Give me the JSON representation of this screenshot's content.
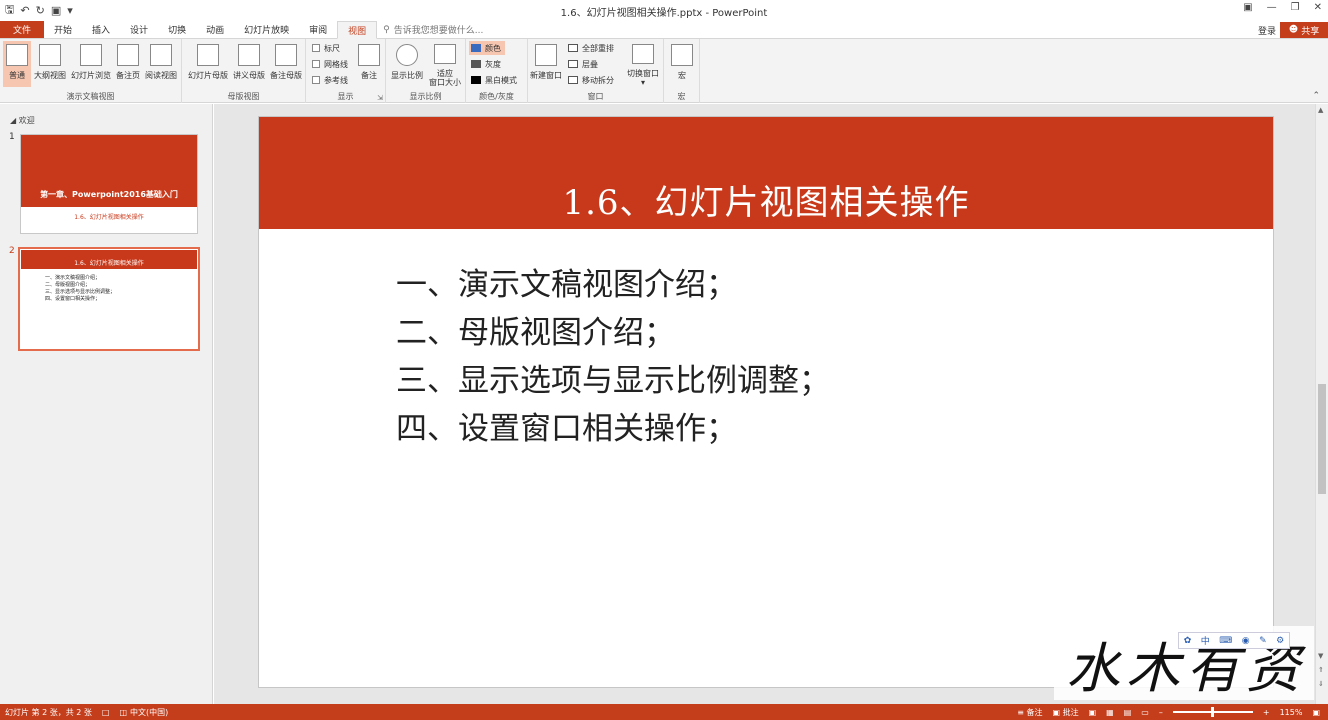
{
  "window": {
    "title": "1.6、幻灯片视图相关操作.pptx - PowerPoint",
    "login": "登录",
    "share": "共享"
  },
  "tabs": [
    "文件",
    "开始",
    "插入",
    "设计",
    "切换",
    "动画",
    "幻灯片放映",
    "审阅",
    "视图"
  ],
  "active_tab": "视图",
  "tell_me": "告诉我您想要做什么...",
  "ribbon": {
    "presentation_views": {
      "label": "演示文稿视图",
      "buttons": [
        "普通",
        "大纲视图",
        "幻灯片浏览",
        "备注页",
        "阅读视图"
      ]
    },
    "master_views": {
      "label": "母版视图",
      "buttons": [
        "幻灯片母版",
        "讲义母版",
        "备注母版"
      ]
    },
    "show": {
      "label": "显示",
      "checks": [
        "标尺",
        "网格线",
        "参考线"
      ],
      "notes": "备注"
    },
    "zoom": {
      "label": "显示比例",
      "zoom_btn": "显示比例",
      "fit_line1": "适应",
      "fit_line2": "窗口大小"
    },
    "color": {
      "label": "颜色/灰度",
      "items": [
        "颜色",
        "灰度",
        "黑白模式"
      ]
    },
    "window": {
      "label": "窗口",
      "new_window": "新建窗口",
      "items": [
        "全部重排",
        "层叠",
        "移动拆分"
      ],
      "switch": "切换窗口"
    },
    "macro": {
      "label": "宏",
      "button": "宏"
    }
  },
  "panel": {
    "section": "欢迎",
    "slides": [
      {
        "num": "1",
        "title": "第一章、Powerpoint2016基础入门",
        "subtitle": "1.6、幻灯片视图相关操作"
      },
      {
        "num": "2",
        "title": "1.6、幻灯片视图相关操作",
        "bullets": [
          "一、演示文稿视图介绍；",
          "二、母版视图介绍；",
          "三、显示选项与显示比例调整；",
          "四、设置窗口相关操作；"
        ]
      }
    ]
  },
  "slide": {
    "title": "1.6、幻灯片视图相关操作",
    "bullets": [
      "一、演示文稿视图介绍；",
      "二、母版视图介绍；",
      "三、显示选项与显示比例调整；",
      "四、设置窗口相关操作；"
    ]
  },
  "ime": {
    "mode": "中"
  },
  "watermark": "水木有资",
  "status": {
    "slide_count": "幻灯片 第 2 张，共 2 张",
    "language": "中文(中国)",
    "notes": "备注",
    "comments": "批注",
    "zoom": "115%"
  }
}
